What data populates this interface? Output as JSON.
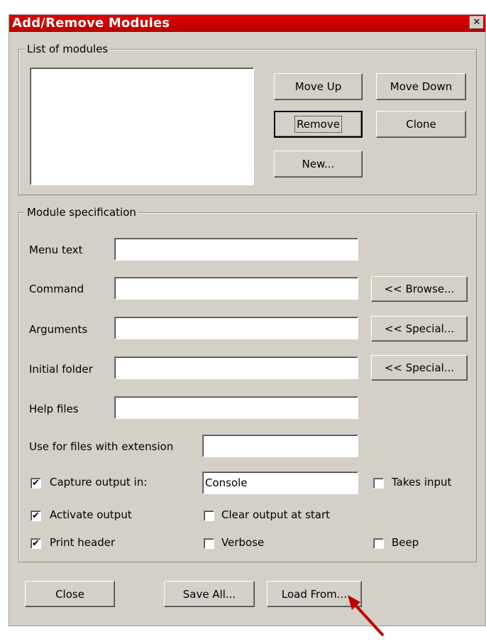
{
  "window": {
    "title": "Add/Remove Modules",
    "close_glyph": "✕"
  },
  "list_group": {
    "legend": "List of modules",
    "move_up": "Move Up",
    "move_down": "Move Down",
    "remove": "Remove",
    "clone": "Clone",
    "new": "New..."
  },
  "spec_group": {
    "legend": "Module specification",
    "menu_text": {
      "label": "Menu text",
      "value": ""
    },
    "command": {
      "label": "Command",
      "value": "",
      "button": "<< Browse..."
    },
    "arguments": {
      "label": "Arguments",
      "value": "",
      "button": "<< Special..."
    },
    "initial_folder": {
      "label": "Initial folder",
      "value": "",
      "button": "<< Special..."
    },
    "help_files": {
      "label": "Help files",
      "value": ""
    },
    "extension": {
      "label": "Use for files with extension",
      "value": ""
    },
    "capture_output": {
      "label": "Capture output in:",
      "checked": true,
      "value": "Console"
    },
    "takes_input": {
      "label": "Takes input",
      "checked": false
    },
    "activate_output": {
      "label": "Activate output",
      "checked": true
    },
    "clear_output": {
      "label": "Clear output at start",
      "checked": false
    },
    "print_header": {
      "label": "Print header",
      "checked": true
    },
    "verbose": {
      "label": "Verbose",
      "checked": false
    },
    "beep": {
      "label": "Beep",
      "checked": false
    }
  },
  "footer": {
    "close": "Close",
    "save_all": "Save All...",
    "load_from": "Load From..."
  },
  "colors": {
    "titlebar": "#cc0000",
    "dialog_bg": "#d4d0c8",
    "annotation_arrow": "#c00000"
  }
}
